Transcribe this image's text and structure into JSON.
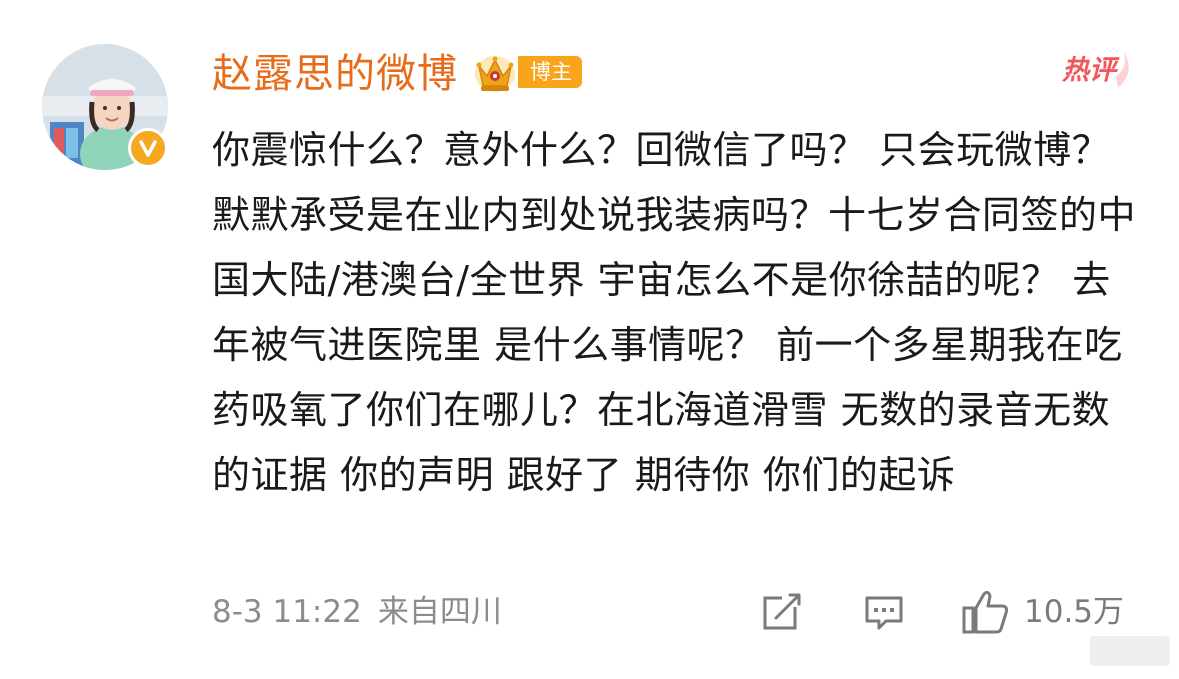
{
  "comment": {
    "username": "赵露思的微博",
    "badge_label": "博主",
    "hot_tag": "热评",
    "text": "你震惊什么？意外什么？回微信了吗？ 只会玩微博？默默承受是在业内到处说我装病吗？十七岁合同签的中国大陆/港澳台/全世界 宇宙怎么不是你徐喆的呢？ 去年被气进医院里 是什么事情呢？ 前一个多星期我在吃药吸氧了你们在哪儿？在北海道滑雪 无数的录音无数的证据 你的声明 跟好了 期待你 你们的起诉",
    "timestamp": "8-3 11:22",
    "location": "来自四川",
    "like_count": "10.5万"
  },
  "icons": {
    "avatar": "avatar-photo",
    "verified": "verified-v-icon",
    "crown": "crown-icon",
    "edit": "share-edit-icon",
    "reply": "comment-icon",
    "like": "thumbs-up-icon"
  },
  "colors": {
    "username": "#e86b1a",
    "badge": "#f9a41b",
    "hot_tag": "#f2575c",
    "verified": "#f6a821",
    "meta": "#8c8c8c"
  }
}
